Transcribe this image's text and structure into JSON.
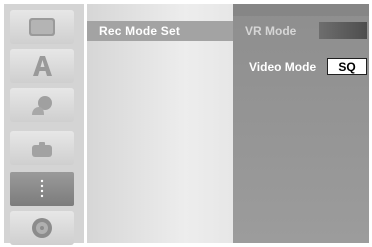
{
  "menu": {
    "title": "Rec Mode Set"
  },
  "sidebar": {
    "items": [
      {
        "icon": "disc-tray-icon"
      },
      {
        "icon": "title-a-icon"
      },
      {
        "icon": "person-icon"
      },
      {
        "icon": "camera-icon"
      },
      {
        "icon": "dots-icon",
        "selected": true
      },
      {
        "icon": "disc-icon"
      }
    ]
  },
  "settings": {
    "vr_mode": {
      "label": "VR Mode"
    },
    "video_mode": {
      "label": "Video Mode",
      "value": "SQ"
    }
  },
  "colors": {
    "selection_bar": "#a3a3a3",
    "panel": "#929292",
    "value_box": "#ffffff"
  }
}
